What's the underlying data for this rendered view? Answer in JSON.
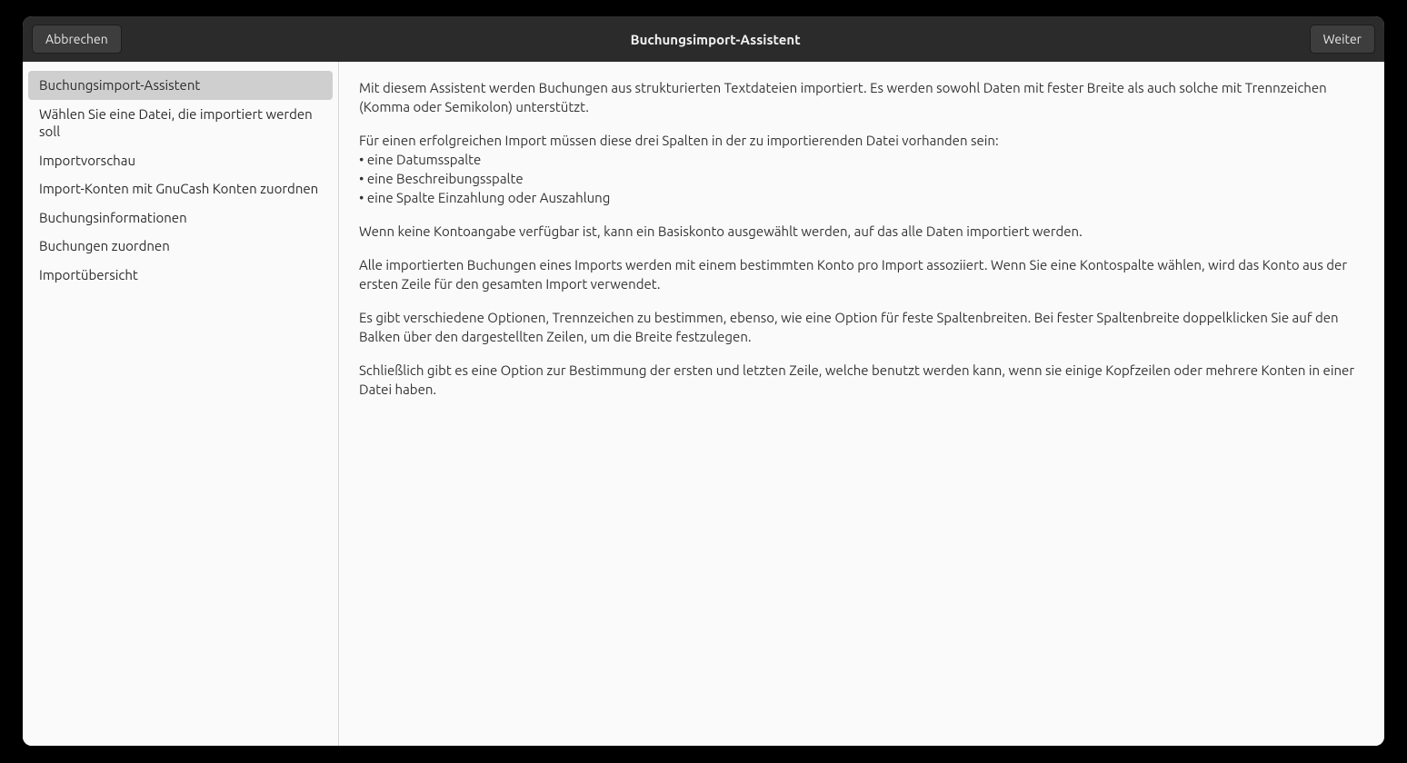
{
  "titlebar": {
    "cancel": "Abbrechen",
    "title": "Buchungsimport-Assistent",
    "next": "Weiter"
  },
  "sidebar": {
    "items": [
      "Buchungsimport-Assistent",
      "Wählen Sie eine Datei, die importiert werden soll",
      "Importvorschau",
      "Import-Konten mit GnuCash Konten zuordnen",
      "Buchungsinformationen",
      "Buchungen zuordnen",
      "Importübersicht"
    ],
    "selectedIndex": 0
  },
  "main": {
    "p1": "Mit diesem Assistent werden Buchungen aus strukturierten Textdateien importiert. Es werden sowohl Daten mit fester Breite als auch solche mit Trennzeichen (Komma oder Semikolon) unterstützt.",
    "p2a": "Für einen erfolgreichen Import müssen diese drei Spalten in der zu importierenden Datei vorhanden sein:",
    "p2b": "• eine Datumsspalte",
    "p2c": "• eine Beschreibungsspalte",
    "p2d": "• eine Spalte Einzahlung oder Auszahlung",
    "p3": "Wenn keine Kontoangabe verfügbar ist, kann ein Basiskonto ausgewählt werden, auf das alle Daten importiert werden.",
    "p4": "Alle importierten Buchungen eines Imports werden mit einem bestimmten Konto pro Import assoziiert. Wenn Sie eine Kontospalte wählen, wird das Konto aus der ersten Zeile für den gesamten Import verwendet.",
    "p5": "Es gibt verschiedene Optionen, Trennzeichen zu bestimmen, ebenso, wie eine Option für feste Spaltenbreiten. Bei fester Spaltenbreite doppelklicken Sie auf den Balken über den dargestellten Zeilen, um die Breite festzulegen.",
    "p6": "Schließlich gibt es eine Option zur Bestimmung der ersten und letzten Zeile, welche benutzt werden kann, wenn sie einige Kopfzeilen oder mehrere Konten in einer Datei haben."
  }
}
